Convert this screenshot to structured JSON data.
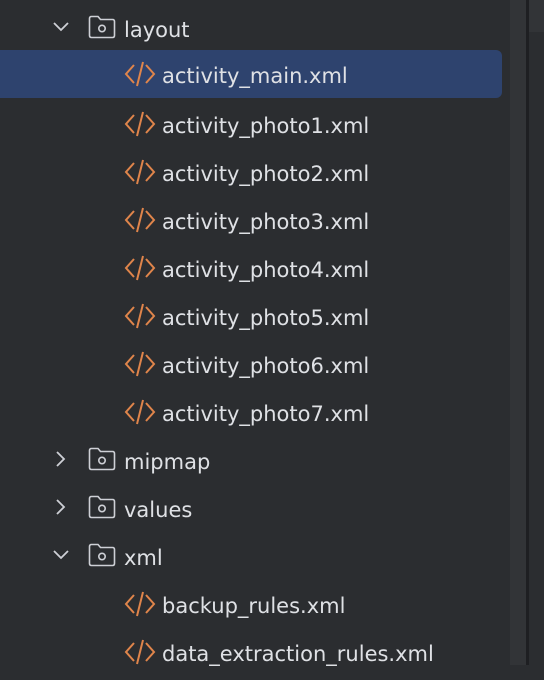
{
  "project_tree": {
    "layout_folder": {
      "label": "layout",
      "icon": "folder-icon",
      "state": "expanded"
    },
    "layout_files": [
      {
        "label": "activity_main.xml",
        "icon": "xml-file-icon",
        "selected": true
      },
      {
        "label": "activity_photo1.xml",
        "icon": "xml-file-icon"
      },
      {
        "label": "activity_photo2.xml",
        "icon": "xml-file-icon"
      },
      {
        "label": "activity_photo3.xml",
        "icon": "xml-file-icon"
      },
      {
        "label": "activity_photo4.xml",
        "icon": "xml-file-icon"
      },
      {
        "label": "activity_photo5.xml",
        "icon": "xml-file-icon"
      },
      {
        "label": "activity_photo6.xml",
        "icon": "xml-file-icon"
      },
      {
        "label": "activity_photo7.xml",
        "icon": "xml-file-icon"
      }
    ],
    "mipmap_folder": {
      "label": "mipmap",
      "icon": "folder-icon",
      "state": "collapsed"
    },
    "values_folder": {
      "label": "values",
      "icon": "folder-icon",
      "state": "collapsed"
    },
    "xml_folder": {
      "label": "xml",
      "icon": "folder-icon",
      "state": "expanded"
    },
    "xml_files": [
      {
        "label": "backup_rules.xml",
        "icon": "xml-file-icon"
      },
      {
        "label": "data_extraction_rules.xml",
        "icon": "xml-file-icon"
      }
    ]
  },
  "colors": {
    "background": "#2b2d30",
    "selection": "#2e436e",
    "text": "#dfe1e5",
    "xml_icon": "#e0854b",
    "folder_icon": "#ced0d6"
  }
}
